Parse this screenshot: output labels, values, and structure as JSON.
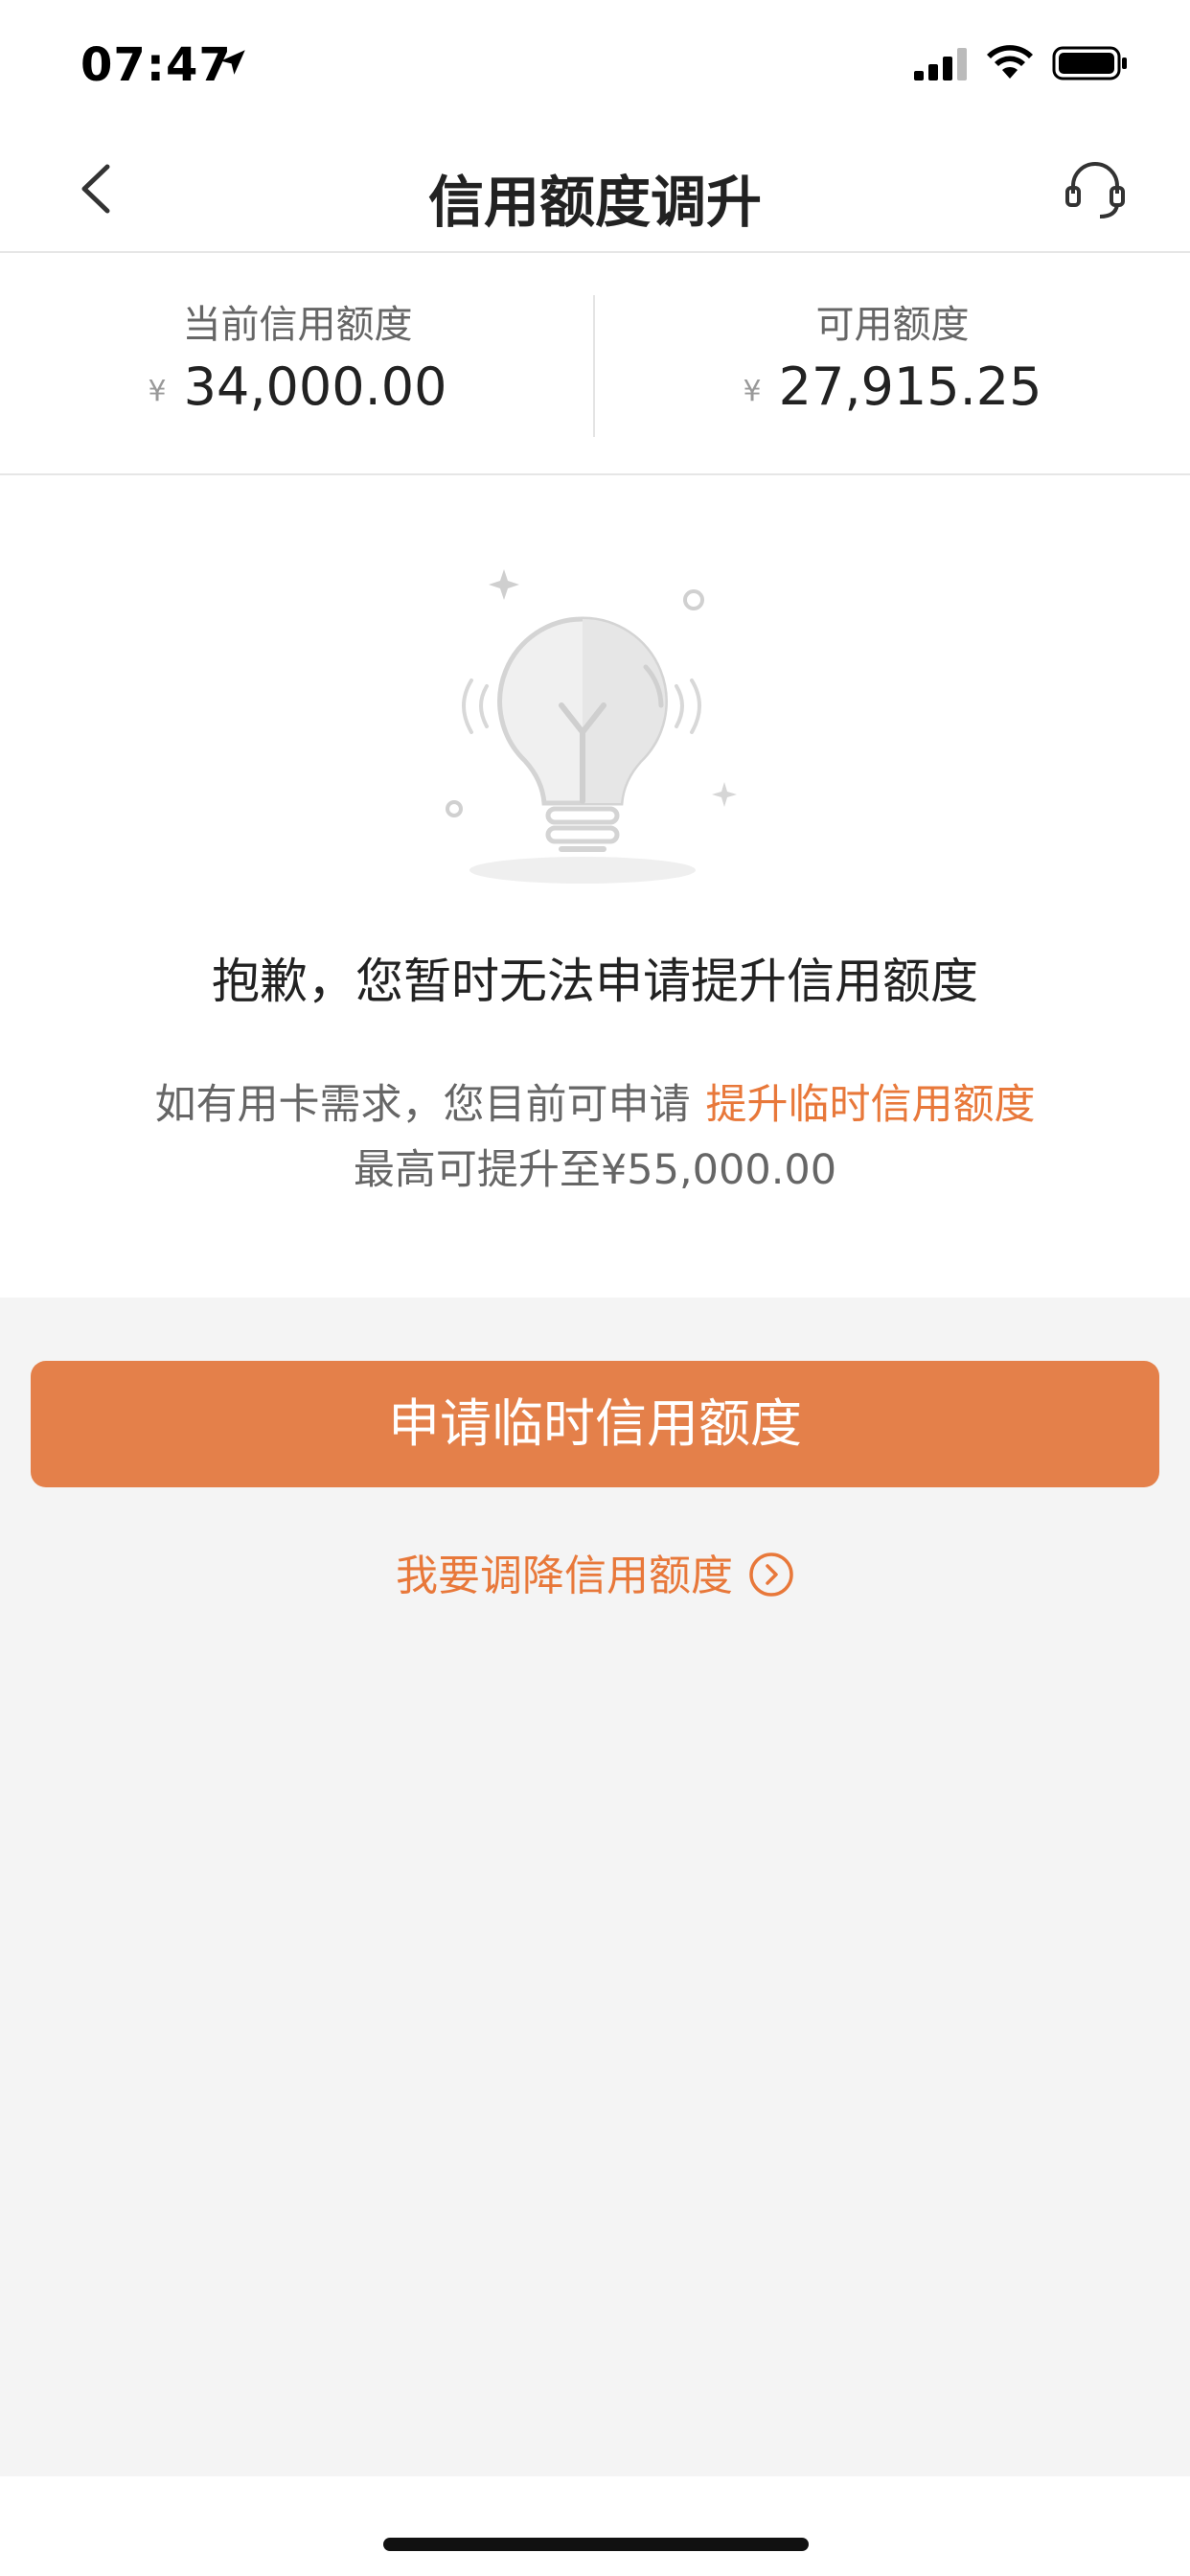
{
  "status_bar": {
    "time": "07:47",
    "icons": [
      "location-arrow-icon",
      "cellular-signal-icon",
      "wifi-icon",
      "battery-icon"
    ]
  },
  "nav": {
    "title": "信用额度调升",
    "back_icon": "chevron-left-icon",
    "service_icon": "headset-icon"
  },
  "summary": {
    "current_label": "当前信用额度",
    "current_currency": "¥",
    "current_value": "34,000.00",
    "available_label": "可用额度",
    "available_currency": "¥",
    "available_value": "27,915.25"
  },
  "message": {
    "illustration": "lightbulb-icon",
    "title": "抱歉，您暂时无法申请提升信用额度",
    "line1_prefix": "如有用卡需求，您目前可申请",
    "line1_link": "提升临时信用额度",
    "line2": "最高可提升至¥55,000.00"
  },
  "actions": {
    "primary_label": "申请临时信用额度",
    "secondary_label": "我要调降信用额度",
    "secondary_icon": "chevron-right-circle-icon"
  },
  "colors": {
    "accent": "#e8783a",
    "button": "#e4804a",
    "background": "#f4f4f4"
  }
}
